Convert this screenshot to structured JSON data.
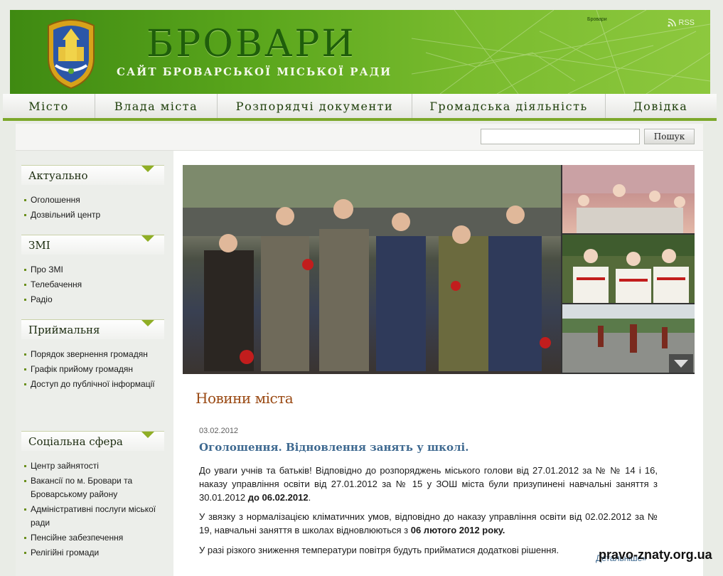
{
  "header": {
    "title": "БРОВАРИ",
    "subtitle": "САЙТ БРОВАРСЬКОЇ МІСЬКОЇ РАДИ",
    "rss_label": "RSS",
    "map_labels": [
      "Бровари"
    ]
  },
  "nav": {
    "items": [
      {
        "label": "Місто"
      },
      {
        "label": "Влада міста"
      },
      {
        "label": "Розпорядчі документи"
      },
      {
        "label": "Громадська діяльність"
      },
      {
        "label": "Довідка"
      }
    ]
  },
  "search": {
    "value": "",
    "button_label": "Пошук"
  },
  "sidebar": {
    "blocks": [
      {
        "title": "Актуально",
        "items": [
          "Оголошення",
          "Дозвільний центр"
        ]
      },
      {
        "title": "ЗМІ",
        "items": [
          "Про ЗМІ",
          "Телебачення",
          "Радіо"
        ]
      },
      {
        "title": "Приймальня",
        "items": [
          "Порядок звернення громадян",
          "Графік прийому громадян",
          "Доступ до публічної інформації"
        ]
      },
      {
        "title": "Соціальна сфера",
        "items": [
          "Центр зайнятості",
          "Вакансії по м. Бровари та Броварському району",
          "Адміністративні послуги міської ради",
          "Пенсійне забезпечення",
          "Релігійні громади"
        ]
      }
    ]
  },
  "news": {
    "section_title": "Новини міста",
    "date": "03.02.2012",
    "headline": "Оголошення. Відновлення занять у школі.",
    "p1_text": "До уваги учнів та батьків! Відповідно до розпоряджень міського голови від 27.01.2012 за № № 14 і 16, наказу управління освіти від 27.01.2012 за № 15 у ЗОШ міста були призупинені навчальні заняття з 30.01.2012 ",
    "p1_bold": "до 06.02.2012",
    "p1_end": ".",
    "p2_text": "У звязку з нормалізацією кліматичних умов, відповідно до наказу управління освіти від 02.02.2012 за № 19, навчальні заняття в школах відновлюються  з  ",
    "p2_bold": "06 лютого 2012 року.",
    "p3_text": "У разі різкого зниження температури повітря будуть прийматися додаткові рішення.",
    "more_label": "Детальніше»"
  },
  "watermark": "pravo-znaty.org.ua",
  "colors": {
    "header_green": "#5aa61c",
    "title_dark_green": "#1f5e0b",
    "nav_underline": "#7ca82a",
    "news_title": "#9a4a14",
    "link_blue": "#3e6990"
  },
  "icons": [
    "rss-icon",
    "city-crest-icon",
    "chevron-down-icon"
  ]
}
